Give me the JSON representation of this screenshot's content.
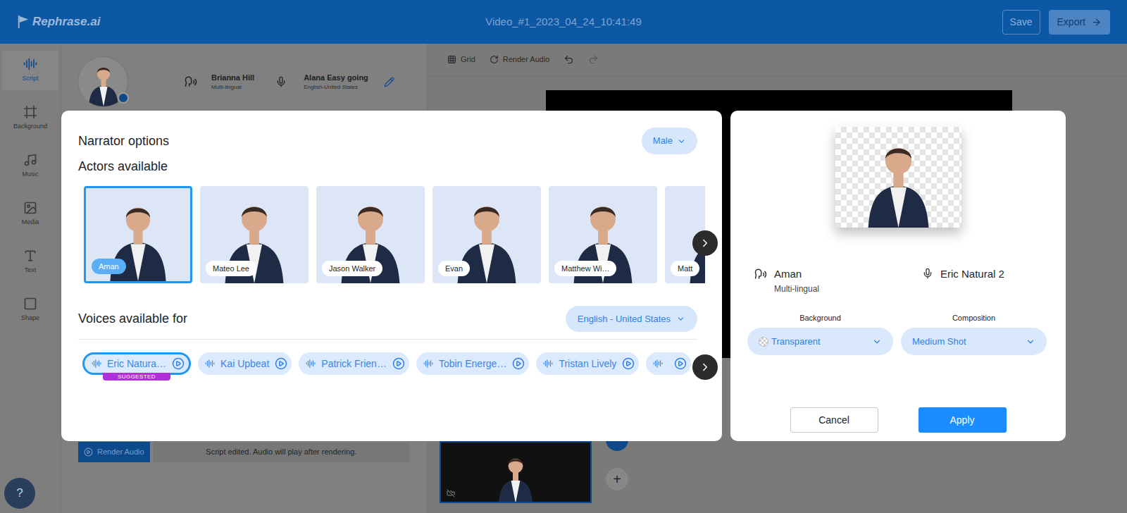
{
  "app_bar": {
    "logo": "Rephrase.ai",
    "title": "Video_#1_2023_04_24_10:41:49",
    "save": "Save",
    "export": "Export"
  },
  "sidebar": [
    {
      "label": "Script",
      "selected": true
    },
    {
      "label": "Background",
      "selected": false
    },
    {
      "label": "Music",
      "selected": false
    },
    {
      "label": "Media",
      "selected": false
    },
    {
      "label": "Text",
      "selected": false
    },
    {
      "label": "Shape",
      "selected": false
    }
  ],
  "current_narrator": {
    "actor": "Brianna Hill",
    "actor_note": "Multi-lingual",
    "voice": "Alana Easy going",
    "voice_note": "English-United States"
  },
  "toolbar": {
    "grid": "Grid",
    "render": "Render Audio"
  },
  "script_footer": {
    "button": "Render Audio",
    "message": "Script edited. Audio will play after rendering."
  },
  "timeline": {
    "thumbnail_selected": true,
    "add": "+"
  },
  "help_button": "?",
  "narrator_options": {
    "title": "Narrator options",
    "gender_filter": "Male",
    "actors_heading": "Actors available",
    "actors": [
      {
        "name": "Aman",
        "selected": true
      },
      {
        "name": "Mateo Lee",
        "selected": false
      },
      {
        "name": "Jason Walker",
        "selected": false
      },
      {
        "name": "Evan",
        "selected": false
      },
      {
        "name": "Matthew Wi…",
        "selected": false
      },
      {
        "name": "Matt",
        "selected": false
      }
    ],
    "voices_heading": "Voices available for",
    "language": "English - United States",
    "suggested_label": "SUGGESTED",
    "voices": [
      {
        "name": "Eric Natura…",
        "selected": true,
        "suggested": true
      },
      {
        "name": "Kai Upbeat",
        "selected": false,
        "suggested": false
      },
      {
        "name": "Patrick Frien…",
        "selected": false,
        "suggested": false
      },
      {
        "name": "Tobin Energe…",
        "selected": false,
        "suggested": false
      },
      {
        "name": "Tristan Lively",
        "selected": false,
        "suggested": false
      },
      {
        "name": "",
        "selected": false,
        "suggested": false
      }
    ]
  },
  "selection_panel": {
    "actor": "Aman",
    "actor_note": "Multi-lingual",
    "voice": "Eric Natural 2",
    "background_label": "Background",
    "background": "Transparent",
    "composition_label": "Composition",
    "composition": "Medium Shot",
    "cancel": "Cancel",
    "apply": "Apply"
  }
}
